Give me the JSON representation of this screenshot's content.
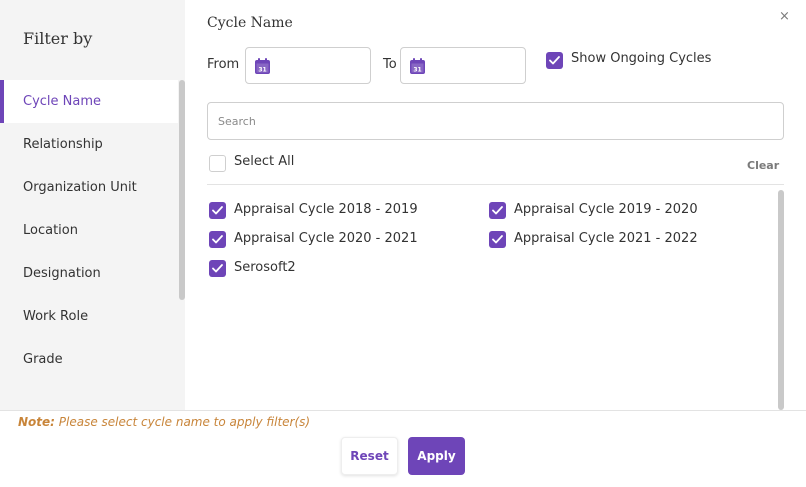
{
  "sidebar": {
    "title": "Filter by",
    "items": [
      {
        "label": "Cycle Name",
        "active": true
      },
      {
        "label": "Relationship"
      },
      {
        "label": "Organization Unit"
      },
      {
        "label": "Location"
      },
      {
        "label": "Designation"
      },
      {
        "label": "Work Role"
      },
      {
        "label": "Grade"
      }
    ]
  },
  "close_symbol": "×",
  "panel": {
    "title": "Cycle Name",
    "from_label": "From",
    "to_label": "To",
    "calendar_day": "31",
    "ongoing_label": "Show Ongoing Cycles",
    "ongoing_checked": true,
    "search_placeholder": "Search",
    "select_all_label": "Select All",
    "select_all_checked": false,
    "clear_label": "Clear",
    "cycles": [
      {
        "label": "Appraisal Cycle 2018 - 2019",
        "checked": true
      },
      {
        "label": "Appraisal Cycle 2019 - 2020",
        "checked": true
      },
      {
        "label": "Appraisal Cycle 2020 - 2021",
        "checked": true
      },
      {
        "label": "Appraisal Cycle 2021 - 2022",
        "checked": true
      },
      {
        "label": "Serosoft2",
        "checked": true
      }
    ]
  },
  "footer": {
    "note_prefix": "Note:",
    "note_text": " Please select cycle name to apply filter(s)",
    "reset_label": "Reset",
    "apply_label": "Apply"
  },
  "colors": {
    "accent": "#6e45b8",
    "note": "#c8853a",
    "sidebar_bg": "#f4f4f4"
  },
  "icons": {
    "calendar": "calendar-icon",
    "close": "close-icon",
    "check": "check-icon"
  }
}
